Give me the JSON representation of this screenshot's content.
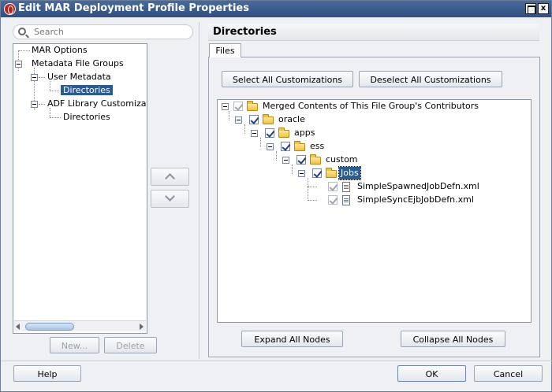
{
  "window": {
    "title": "Edit MAR Deployment Profile Properties",
    "maximize_glyph": "",
    "close_glyph": "x"
  },
  "search": {
    "placeholder": "Search"
  },
  "nav": {
    "items": [
      {
        "label": "MAR Options"
      },
      {
        "label": "Metadata File Groups"
      },
      {
        "label": "User Metadata"
      },
      {
        "label": "Directories"
      },
      {
        "label": "ADF Library Customizat"
      },
      {
        "label": "Directories"
      }
    ],
    "new_label": "New...",
    "delete_label": "Delete"
  },
  "panel": {
    "title": "Directories",
    "tab": "Files",
    "select_all_label": "Select All Customizations",
    "deselect_all_label": "Deselect All Customizations",
    "expand_label": "Expand All Nodes",
    "collapse_label": "Collapse All Nodes"
  },
  "files_tree": {
    "nodes": [
      {
        "label": "Merged Contents of This File Group's Contributors",
        "checked": true,
        "icon": "folder-icon"
      },
      {
        "label": "oracle",
        "checked": true,
        "icon": "folder-icon"
      },
      {
        "label": "apps",
        "checked": true,
        "icon": "folder-icon"
      },
      {
        "label": "ess",
        "checked": true,
        "icon": "folder-icon"
      },
      {
        "label": "custom",
        "checked": true,
        "icon": "folder-icon"
      },
      {
        "label": "Jobs",
        "checked": true,
        "icon": "folder-icon",
        "selected": true
      },
      {
        "label": "SimpleSpawnedJobDefn.xml",
        "checked": true,
        "icon": "file-icon"
      },
      {
        "label": "SimpleSyncEjbJobDefn.xml",
        "checked": true,
        "icon": "file-icon"
      }
    ]
  },
  "footer": {
    "help_label": "Help",
    "ok_label": "OK",
    "cancel_label": "Cancel"
  },
  "colors": {
    "titlebar": "#2f4f7f",
    "selection": "#2a5b93",
    "background": "#eef0f3"
  }
}
